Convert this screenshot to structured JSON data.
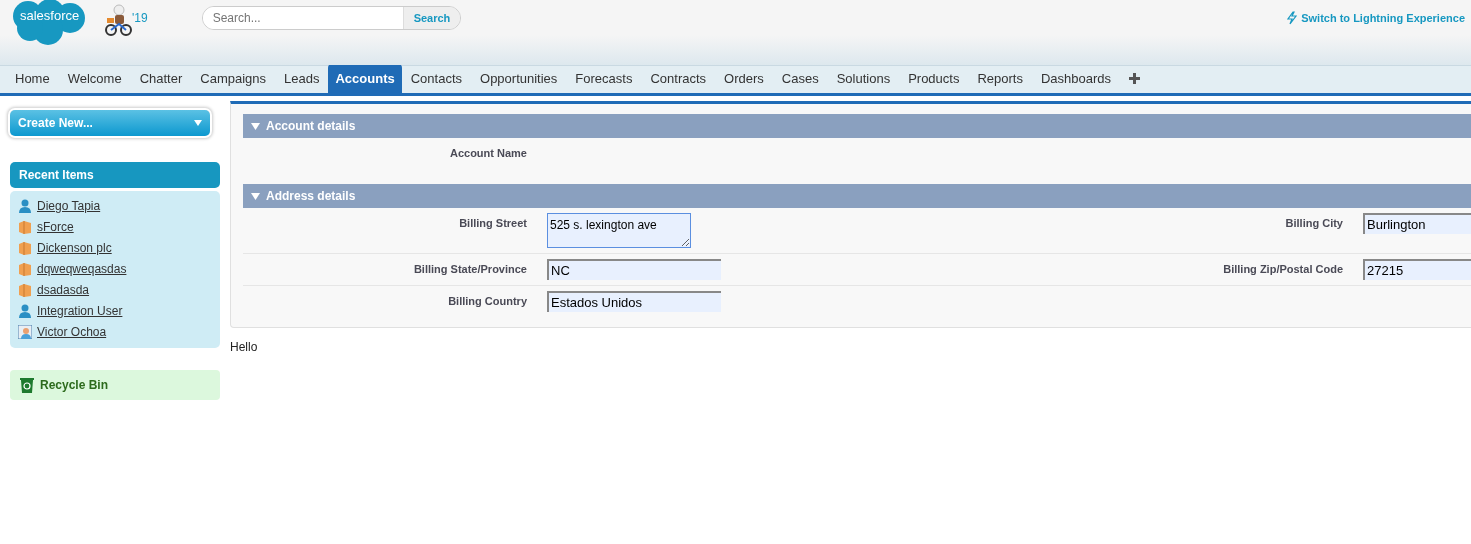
{
  "header": {
    "logo": "salesforce",
    "release": "'19",
    "search": {
      "placeholder": "Search...",
      "button": "Search"
    },
    "switch_link": "Switch to Lightning Experience"
  },
  "tabs": [
    {
      "label": "Home",
      "selected": false
    },
    {
      "label": "Welcome",
      "selected": false
    },
    {
      "label": "Chatter",
      "selected": false
    },
    {
      "label": "Campaigns",
      "selected": false
    },
    {
      "label": "Leads",
      "selected": false
    },
    {
      "label": "Accounts",
      "selected": true
    },
    {
      "label": "Contacts",
      "selected": false
    },
    {
      "label": "Opportunities",
      "selected": false
    },
    {
      "label": "Forecasts",
      "selected": false
    },
    {
      "label": "Contracts",
      "selected": false
    },
    {
      "label": "Orders",
      "selected": false
    },
    {
      "label": "Cases",
      "selected": false
    },
    {
      "label": "Solutions",
      "selected": false
    },
    {
      "label": "Products",
      "selected": false
    },
    {
      "label": "Reports",
      "selected": false
    },
    {
      "label": "Dashboards",
      "selected": false
    }
  ],
  "sidebar": {
    "create_new": "Create New...",
    "recent_title": "Recent Items",
    "recent_items": [
      {
        "label": "Diego Tapia",
        "kind": "person"
      },
      {
        "label": "sForce",
        "kind": "account"
      },
      {
        "label": "Dickenson plc",
        "kind": "account"
      },
      {
        "label": "dqweqweqasdas",
        "kind": "account"
      },
      {
        "label": "dsadasda",
        "kind": "account"
      },
      {
        "label": "Integration User",
        "kind": "person"
      },
      {
        "label": "Victor Ochoa",
        "kind": "photo"
      }
    ],
    "recycle_bin": "Recycle Bin"
  },
  "sections": [
    {
      "title": "Account details",
      "rows": [
        [
          {
            "label": "Account Name"
          }
        ]
      ]
    },
    {
      "title": "Address details",
      "rows": [
        [
          {
            "label": "Billing Street",
            "value": "525 s. lexington ave",
            "kind": "textarea"
          },
          {
            "label": "Billing City",
            "value": "Burlington",
            "kind": "input"
          }
        ],
        [
          {
            "label": "Billing State/Province",
            "value": "NC",
            "kind": "input"
          },
          {
            "label": "Billing Zip/Postal Code",
            "value": "27215",
            "kind": "input"
          }
        ],
        [
          {
            "label": "Billing Country",
            "value": "Estados Unidos",
            "kind": "input"
          }
        ]
      ]
    }
  ],
  "footer_text": "Hello"
}
